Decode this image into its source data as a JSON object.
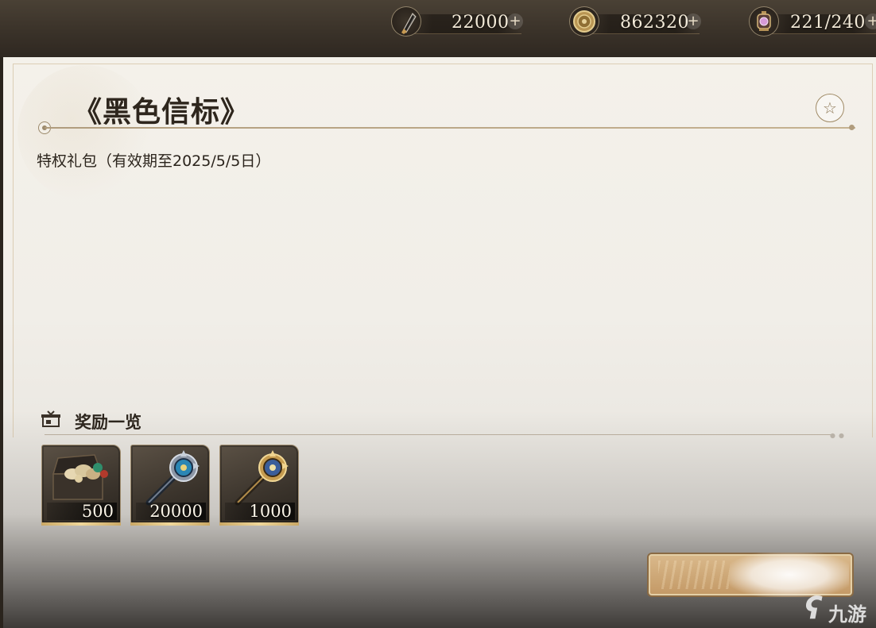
{
  "currencies": [
    {
      "name": "crystal-icon",
      "value": "22000",
      "plus": "+"
    },
    {
      "name": "gold-coin-icon",
      "value": "862320",
      "plus": "+"
    },
    {
      "name": "lantern-icon",
      "value": "221/240",
      "plus": "+"
    }
  ],
  "panel": {
    "title": "《黑色信标》",
    "subtitle": "特权礼包（有效期至2025/5/5日）",
    "favorite_icon": "star-icon"
  },
  "rewards": {
    "heading": "奖励一览",
    "items": [
      {
        "icon": "treasure-chest-icon",
        "count": "500"
      },
      {
        "icon": "blue-key-icon",
        "count": "20000"
      },
      {
        "icon": "gold-key-icon",
        "count": "1000"
      }
    ]
  },
  "watermark": {
    "logo": "ʕ",
    "text": "九游"
  }
}
